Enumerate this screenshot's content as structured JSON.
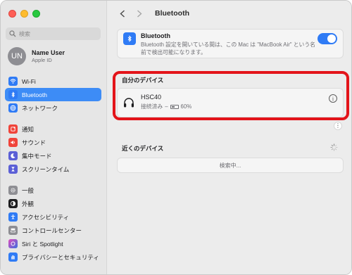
{
  "window": {
    "controls": [
      "close",
      "minimize",
      "zoom"
    ]
  },
  "sidebar": {
    "search_placeholder": "検索",
    "profile": {
      "initials": "UN",
      "name": "Name User",
      "sub": "Apple ID"
    },
    "groups": [
      [
        {
          "label": "Wi-Fi",
          "icon": "wifi-icon",
          "color": "#2f7bf5"
        },
        {
          "label": "Bluetooth",
          "icon": "bluetooth-icon",
          "color": "#2f7bf5",
          "active": true
        },
        {
          "label": "ネットワーク",
          "icon": "globe-icon",
          "color": "#2f7bf5"
        }
      ],
      [
        {
          "label": "通知",
          "icon": "bell-icon",
          "color": "#f0443a"
        },
        {
          "label": "サウンド",
          "icon": "speaker-icon",
          "color": "#f0443a"
        },
        {
          "label": "集中モード",
          "icon": "moon-icon",
          "color": "#5b5fd6"
        },
        {
          "label": "スクリーンタイム",
          "icon": "hourglass-icon",
          "color": "#5b5fd6"
        }
      ],
      [
        {
          "label": "一般",
          "icon": "gear-icon",
          "color": "#8e8e93"
        },
        {
          "label": "外観",
          "icon": "appearance-icon",
          "color": "#1d1d1f"
        },
        {
          "label": "アクセシビリティ",
          "icon": "accessibility-icon",
          "color": "#2f7bf5"
        },
        {
          "label": "コントロールセンター",
          "icon": "control-center-icon",
          "color": "#8e8e93"
        },
        {
          "label": "Siri と Spotlight",
          "icon": "siri-icon",
          "color": "#6a4fd6"
        },
        {
          "label": "プライバシーとセキュリティ",
          "icon": "hand-icon",
          "color": "#2f7bf5"
        }
      ]
    ]
  },
  "toolbar": {
    "title": "Bluetooth"
  },
  "bluetooth": {
    "title": "Bluetooth",
    "description": "Bluetooth 設定を開いている間は、この Mac は \"MacBook Air\" という名前で検出可能になります。",
    "enabled": true
  },
  "my_devices": {
    "title": "自分のデバイス",
    "devices": [
      {
        "name": "HSC40",
        "status": "接続済み",
        "separator": "–",
        "battery": "60%",
        "battery_level": 0.6
      }
    ]
  },
  "nearby": {
    "title": "近くのデバイス",
    "scanning": "検索中..."
  },
  "colors": {
    "accent": "#2f7bf5",
    "highlight": "#e3141a"
  }
}
